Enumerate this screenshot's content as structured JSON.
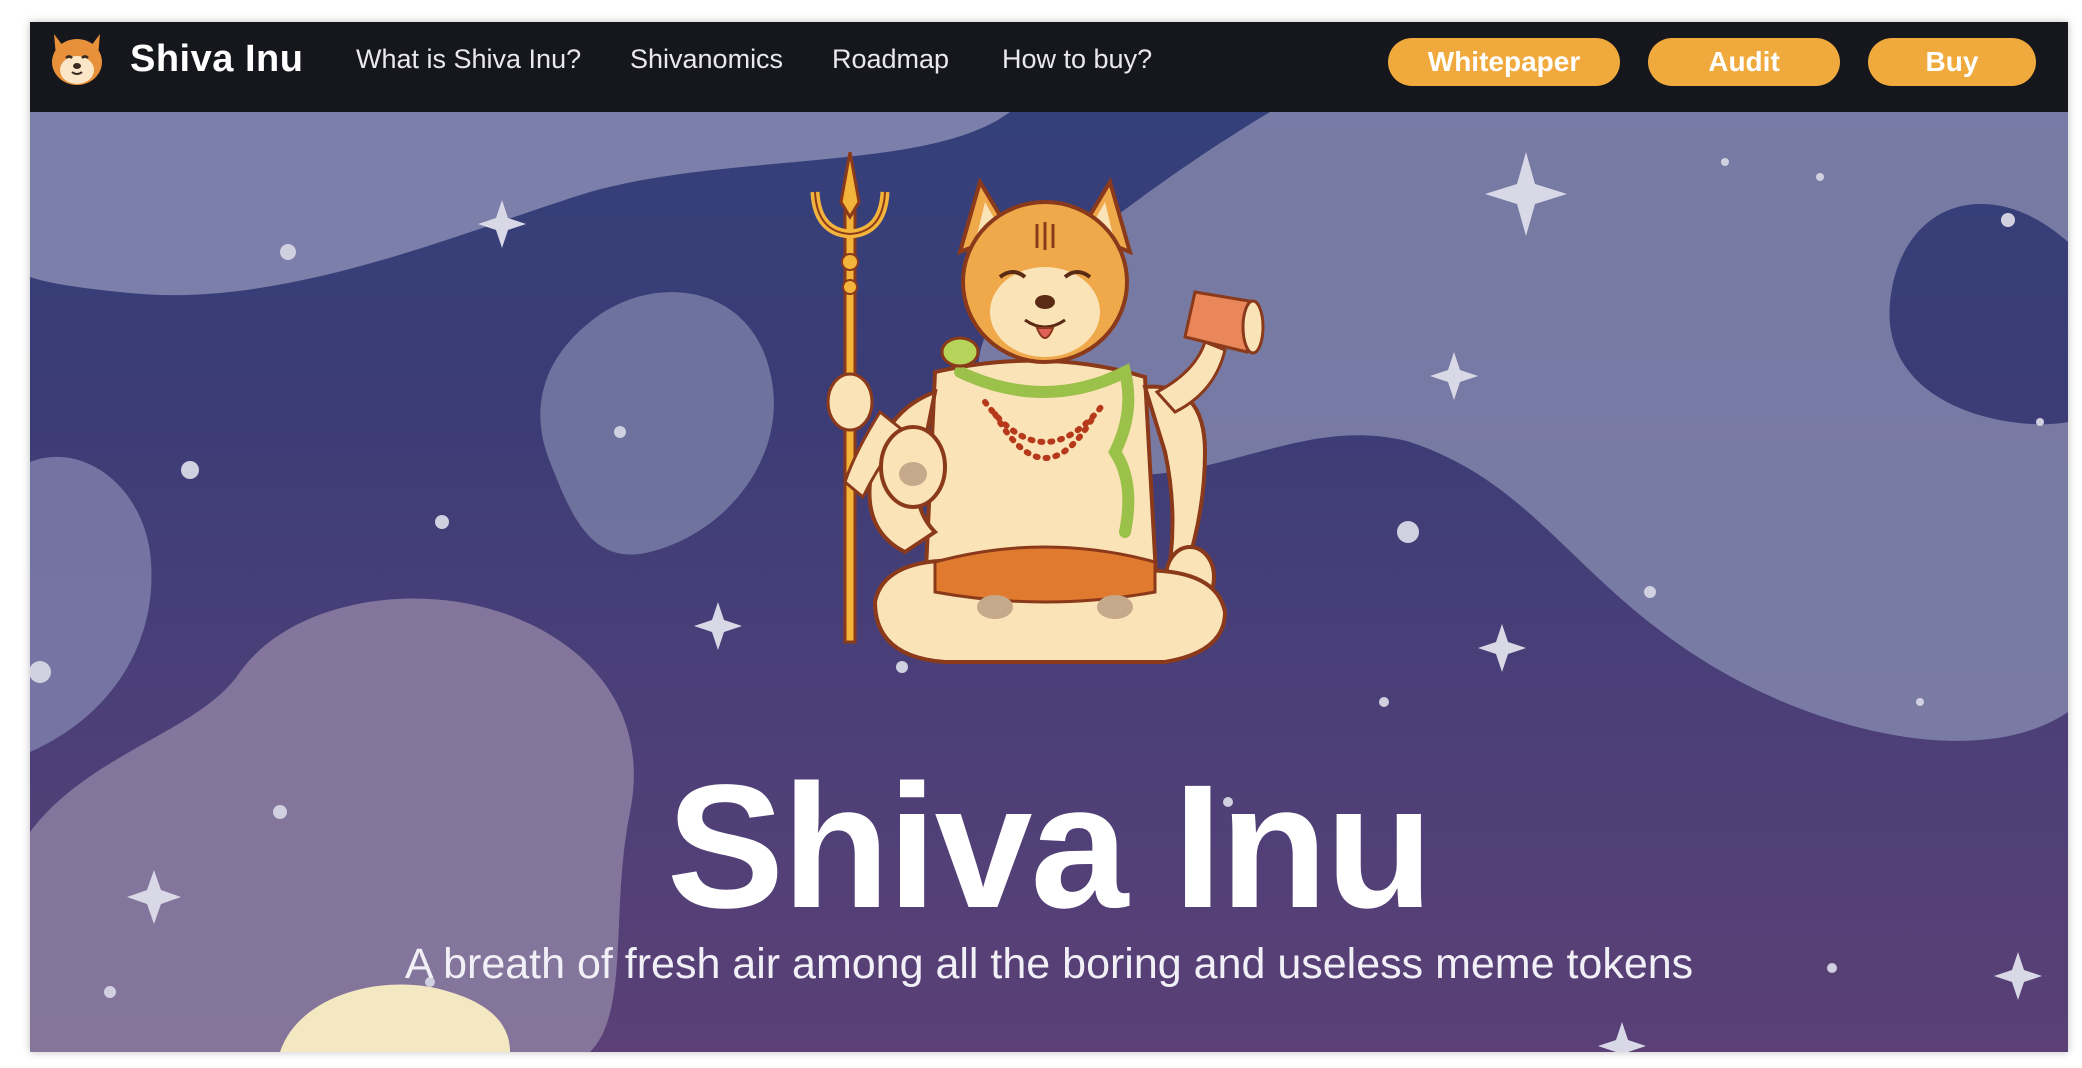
{
  "brand": {
    "name": "Shiva Inu",
    "logo_icon": "shiba-head-icon"
  },
  "nav": {
    "links": [
      "What is Shiva Inu?",
      "Shivanomics",
      "Roadmap",
      "How to buy?"
    ],
    "buttons": [
      "Whitepaper",
      "Audit",
      "Buy"
    ]
  },
  "hero": {
    "title": "Shiva Inu",
    "subtitle": "A breath of fresh air among all the boring and useless meme tokens",
    "illustration": "shiba-shiva-mascot"
  },
  "colors": {
    "nav_bg": "#15171c",
    "accent": "#f0a93c",
    "hero_bg": "#3a3f7a",
    "cloud": "#7d7fa8",
    "text": "#ffffff"
  }
}
